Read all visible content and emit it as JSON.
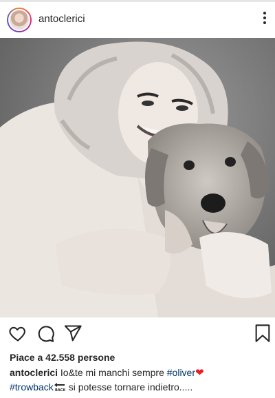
{
  "post": {
    "username": "antoclerici",
    "likes_text": "Piace a 42.558 persone",
    "caption": {
      "author": "antoclerici",
      "text_1": " Io&te mi manchi sempre ",
      "hashtag_1": "#oliver",
      "hashtag_2": "#trowback",
      "text_2": " si potesse tornare indietro....."
    }
  },
  "icons": {
    "more": "more-vertical-icon",
    "like": "heart-icon",
    "comment": "comment-icon",
    "share": "send-icon",
    "save": "bookmark-icon",
    "emoji_heart": "red-heart-emoji",
    "emoji_back": "back-arrow-emoji"
  },
  "colors": {
    "text": "#262626",
    "hashtag": "#003569",
    "heart": "#ed1c24"
  }
}
